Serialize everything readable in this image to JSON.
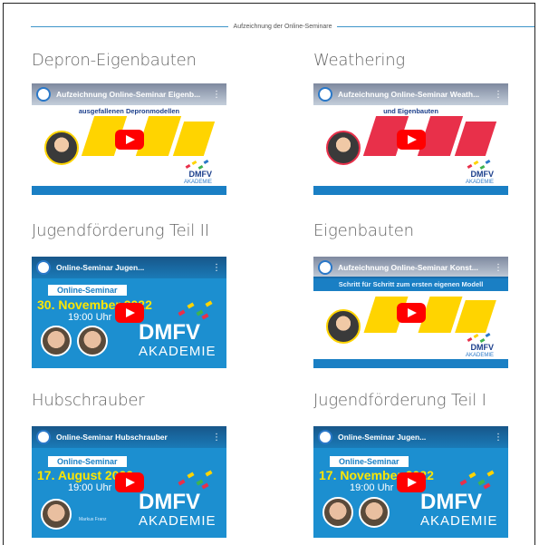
{
  "section": {
    "label": "Aufzeichnung der Online-Seminare"
  },
  "colors": {
    "accent": "#3f95c9",
    "youtube_red": "#ff0000",
    "brand_blue": "#1a7fc4",
    "yellow": "#ffd400",
    "red": "#e8304a"
  },
  "videos": [
    {
      "title": "Depron-Eigenbauten",
      "thumb": {
        "overlay_title": "Aufzeichnung Online-Seminar Eigenb...",
        "subtitle": "ausgefallenen Depronmodellen",
        "brand": "DMFV",
        "brand_sub": "AKADEMIE",
        "play_icon": "youtube-play-icon",
        "menu_icon": "more-vert-icon"
      }
    },
    {
      "title": "Weathering",
      "thumb": {
        "overlay_title": "Aufzeichnung Online-Seminar Weath...",
        "subtitle": "und Eigenbauten",
        "brand": "DMFV",
        "brand_sub": "AKADEMIE",
        "play_icon": "youtube-play-icon",
        "menu_icon": "more-vert-icon"
      }
    },
    {
      "title": "Jugendförderung Teil II",
      "thumb": {
        "overlay_title": "Online-Seminar Jugen...",
        "pill": "Online-Seminar",
        "date": "30. November 2022",
        "time": "19:00 Uhr",
        "brand": "DMFV",
        "brand_sub": "AKADEMIE",
        "play_icon": "youtube-play-icon",
        "menu_icon": "more-vert-icon"
      }
    },
    {
      "title": "Eigenbauten",
      "thumb": {
        "overlay_title": "Aufzeichnung Online-Seminar Konst...",
        "subtitle": "Schritt für Schritt zum ersten eigenen Modell",
        "brand": "DMFV",
        "brand_sub": "AKADEMIE",
        "play_icon": "youtube-play-icon",
        "menu_icon": "more-vert-icon"
      }
    },
    {
      "title": "Hubschrauber",
      "thumb": {
        "overlay_title": "Online-Seminar Hubschrauber",
        "pill": "Online-Seminar",
        "date": "17. August 2022",
        "time": "19:00 Uhr",
        "speaker": "Markus Franz",
        "brand": "DMFV",
        "brand_sub": "AKADEMIE",
        "play_icon": "youtube-play-icon",
        "menu_icon": "more-vert-icon"
      }
    },
    {
      "title": "Jugendförderung Teil I",
      "thumb": {
        "overlay_title": "Online-Seminar Jugen...",
        "pill": "Online-Seminar",
        "date": "17. November 2022",
        "time": "19:00 Uhr",
        "brand": "DMFV",
        "brand_sub": "AKADEMIE",
        "play_icon": "youtube-play-icon",
        "menu_icon": "more-vert-icon"
      }
    }
  ]
}
